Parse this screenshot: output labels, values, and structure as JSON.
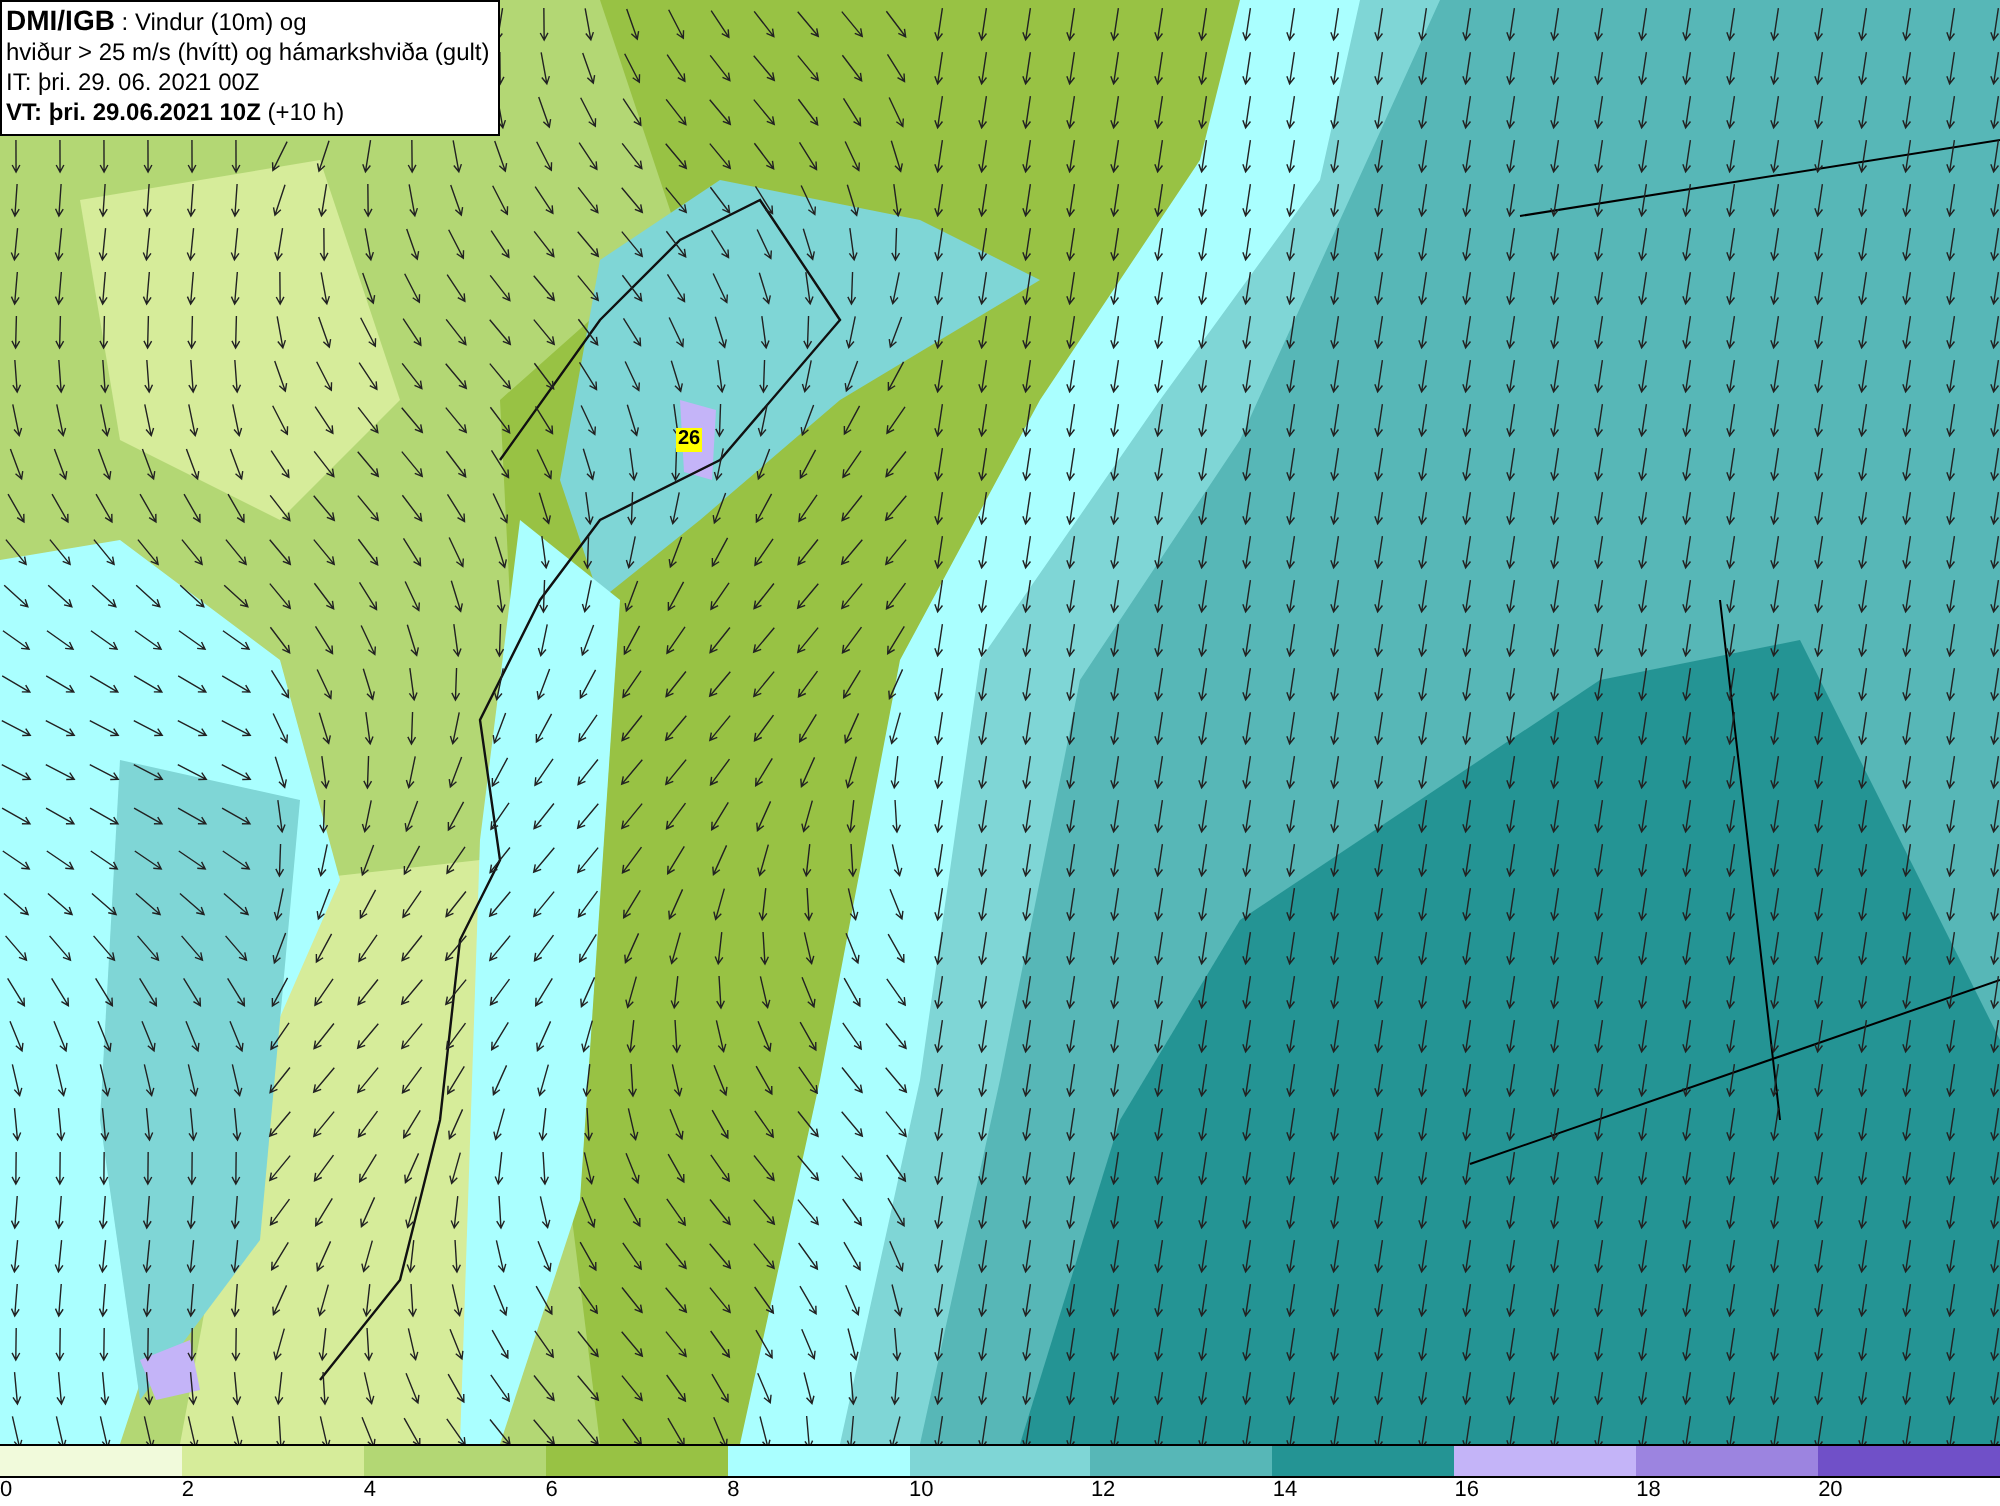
{
  "map": {
    "title_lines": [
      "**DMI/IGB** : Vindur (10m) og",
      "hviður > 25 m/s (hvítt) og hámarkshviða (gult)",
      "IT: þri. 29. 06. 2021 00Z",
      "**VT: þri. 29.06.2021 10Z** (+10 h)"
    ],
    "max_gust_label": "26"
  },
  "legend": {
    "segments": [
      {
        "color": "#f1fadb"
      },
      {
        "color": "#d6ec9a"
      },
      {
        "color": "#b3d774"
      },
      {
        "color": "#98c244"
      },
      {
        "color": "#aaffff"
      },
      {
        "color": "#7fd6d6"
      },
      {
        "color": "#57b7b7"
      },
      {
        "color": "#249494"
      },
      {
        "color": "#c4b4f8"
      },
      {
        "color": "#9c84e0"
      },
      {
        "color": "#7050c8"
      }
    ],
    "ticks": [
      "0",
      "2",
      "4",
      "6",
      "8",
      "10",
      "12",
      "14",
      "16",
      "18",
      "20"
    ]
  }
}
